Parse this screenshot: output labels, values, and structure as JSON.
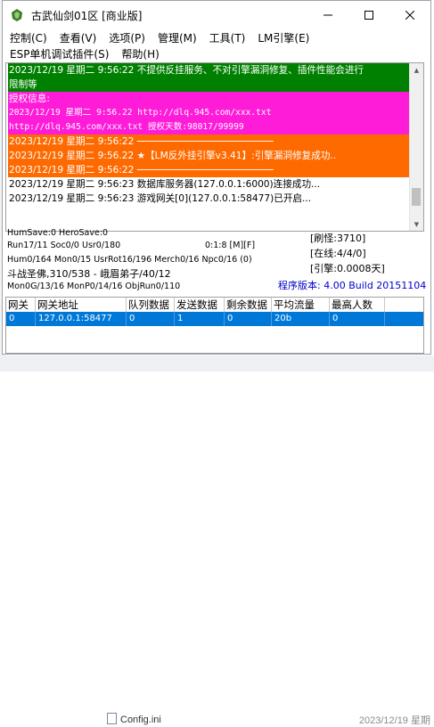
{
  "window": {
    "title": "古武仙剑01区 [商业版]"
  },
  "menus": [
    "控制(C)",
    "查看(V)",
    "选项(P)",
    "管理(M)",
    "工具(T)",
    "LM引擎(E)"
  ],
  "menus2": [
    "ESP单机调试插件(S)",
    "帮助(H)"
  ],
  "log_lines": [
    {
      "style": "g",
      "text": "2023/12/19 星期二 9:56:22 不提供反挂服务、不对引擎漏洞修复、插件性能会进行"
    },
    {
      "style": "g",
      "text": "限制等"
    },
    {
      "style": "m",
      "text": "授权信息:"
    },
    {
      "style": "m",
      "text": "2023/12/19 星期二 9:56.22 http://dlq.945.com/xxx.txt"
    },
    {
      "style": "m",
      "text": "http://dlq.945.com/xxx.txt 授权天数:98017/99999"
    },
    {
      "style": "o",
      "text": "2023/12/19 星期二 9:56:22 ────────────────────────"
    },
    {
      "style": "o",
      "text": "2023/12/19 星期二 9:56.22 ★【LM反外挂引擎v3.41】:引擎漏洞修复成功.."
    },
    {
      "style": "o",
      "text": "2023/12/19 星期二 9:56:22 ────────────────────────"
    },
    {
      "style": "k",
      "text": "2023/12/19 星期二 9:56:23 数据库服务器(127.0.0.1:6000)连接成功..."
    },
    {
      "style": "k",
      "text": "2023/12/19 星期二 9:56:23 游戏网关[0](127.0.0.1:58477)已开启..."
    }
  ],
  "stats": {
    "line1": "HumSave:0 HeroSave:0",
    "line2a": "Run17/11 Soc0/0 Usr0/180",
    "line2b": "0:1:8 [M][F]",
    "line3": "Hum0/164 Mon0/15 UsrRot16/196 Merch0/16 Npc0/16 (0)",
    "line4": "斗战圣佛,310/538 - 峨眉弟子/40/12",
    "line5": "Mon0G/13/16 MonP0/14/16 ObjRun0/110",
    "refresh": "[刷怪:3710]",
    "online": "[在线:4/4/0]",
    "engine": "[引擎:0.0008天]",
    "version": "程序版本: 4.00 Build 20151104"
  },
  "table": {
    "headers": [
      "网关",
      "网关地址",
      "队列数据",
      "发送数据",
      "剩余数据",
      "平均流量",
      "最高人数"
    ],
    "rows": [
      [
        "0",
        "127.0.0.1:58477",
        "0",
        "1",
        "0",
        "20b",
        "0"
      ]
    ]
  },
  "desktop": {
    "file": "Config.ini",
    "date": "2023/12/19 星期"
  },
  "colors": {
    "green": "#008000",
    "magenta": "#ff1cd9",
    "orange": "#ff6a00",
    "selection": "#0078d7",
    "version_blue": "#0000cc"
  }
}
